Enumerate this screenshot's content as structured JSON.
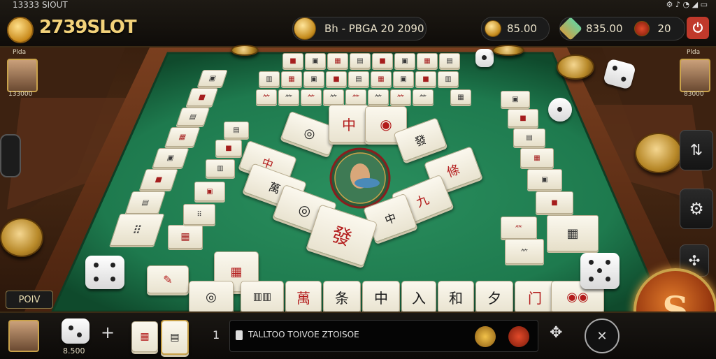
{
  "status_bar": {
    "left_text": "13333 SIOUT"
  },
  "header": {
    "logo_text": "2739SLOT",
    "center_label": "Bh - PBGA 20 2090",
    "balance_1": "85.00",
    "balance_2": "835.00",
    "bet_value": "20"
  },
  "players": {
    "left": {
      "name": "Plda",
      "score": "133000"
    },
    "right": {
      "name": "Plda",
      "score": "83000"
    },
    "bottom": {
      "score": "8.500"
    }
  },
  "table": {
    "poiv_label": "POIV",
    "hand_tiles": [
      "萬",
      "条",
      "中",
      "入",
      "和",
      "夕",
      "门"
    ],
    "center_tiles": [
      "中",
      "發",
      "中",
      "條",
      "萬",
      "九",
      "中",
      "發"
    ]
  },
  "footer": {
    "message": "TALLTOO TOIVOE ZTOISOE",
    "plus_symbol": "+",
    "count_symbol": "1"
  },
  "colors": {
    "felt": "#1e7a4e",
    "gold": "#c9a24a",
    "tile": "#f4f0e2",
    "red_glyph": "#b31b1b"
  },
  "icons": [
    "settings-icon",
    "discard-icon",
    "music-icon",
    "power-icon",
    "compass-icon",
    "spin-icon"
  ]
}
